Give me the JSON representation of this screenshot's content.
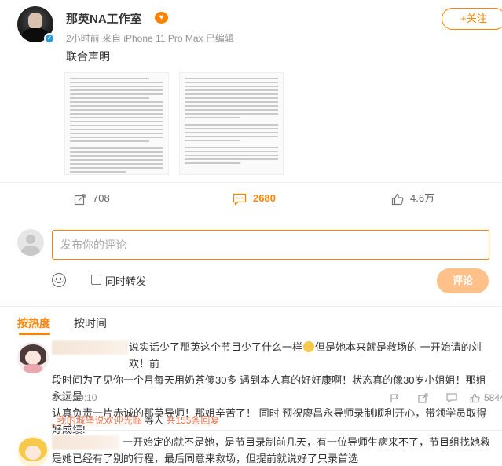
{
  "post": {
    "username": "那英NA工作室",
    "vip_badge": "♥",
    "meta": "2小时前 来自 iPhone 11 Pro Max 已编辑",
    "follow_label": "+关注",
    "text": "联合声明"
  },
  "actions": {
    "reposts": "708",
    "comments": "2680",
    "likes": "4.6万"
  },
  "composer": {
    "placeholder": "发布你的评论",
    "repost_label": "同时转发",
    "submit_label": "评论"
  },
  "sort": {
    "hot": "按热度",
    "time": "按时间"
  },
  "comments": [
    {
      "line1": "说实话少了那英这个节目少了什么一样",
      "line1b": "但是她本来就是救场的 一开始请的刘欢！前",
      "line2": "段时间为了见你一个月每天用奶茶傻30多 遇到本人真的好好康啊！状态真的像30岁小姐姐！那姐永远是",
      "line3": "认真负责一片赤诚的那英导师！那姐辛苦了！ 同时 预祝廖昌永导师录制顺利开心，带领学员取得好成绩!",
      "time": "8-22 20:10",
      "likes": "5844",
      "reply_user": "_我的城堡说欢迎光临",
      "reply_mid": "等人",
      "reply_count": "共155条回复"
    },
    {
      "line1": "一开始定的就不是她，是节目录制前几天，有一位导师生病来不了，节目组找她救场，但",
      "line2": "是她已经有了别的行程，最后同意来救场，但提前就说好了只录首选"
    }
  ],
  "colors": {
    "accent": "#ff8200",
    "reply_link": "#eb7350"
  }
}
